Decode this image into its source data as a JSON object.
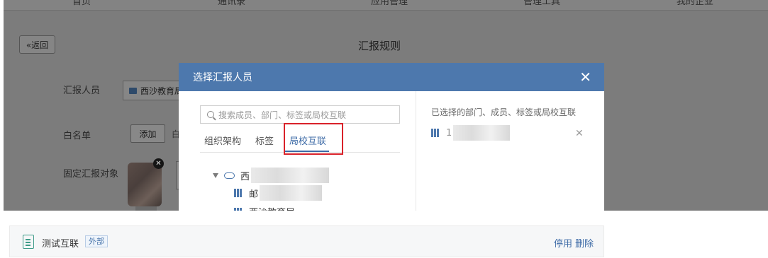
{
  "top_nav": [
    "首页",
    "通讯录",
    "应用管理",
    "管理工具",
    "我的企业"
  ],
  "page": {
    "back_label": "«返回",
    "title": "汇报规则",
    "report_person_label": "汇报人员",
    "report_person_value": "西沙教育局",
    "whitelist_label": "白名单",
    "add_label": "添加",
    "add_hint": "白",
    "fixed_target_label": "固定汇报对象"
  },
  "modal": {
    "title": "选择汇报人员",
    "search_placeholder": "搜索成员、部门、标签或局校互联",
    "tabs": [
      "组织架构",
      "标签",
      "局校互联"
    ],
    "active_tab": "局校互联",
    "tree": {
      "root_label": "西",
      "child_label": "邮",
      "child2_label": "西沙教育局"
    },
    "selected_title": "已选择的部门、成员、标签或局校互联",
    "selected_item_label": "1"
  },
  "panel": {
    "name": "测试互联",
    "tag": "外部",
    "disable_label": "停用",
    "delete_label": "删除"
  },
  "colors": {
    "accent": "#4d78ad",
    "highlight": "#d9222a",
    "overlay": "#7c7c7c",
    "panel_icon": "#3e9b88"
  }
}
